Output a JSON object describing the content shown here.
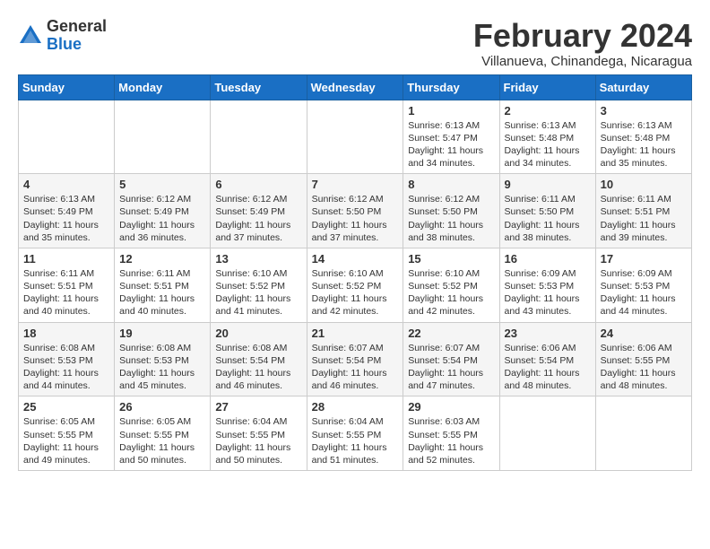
{
  "header": {
    "logo_general": "General",
    "logo_blue": "Blue",
    "month_title": "February 2024",
    "location": "Villanueva, Chinandega, Nicaragua"
  },
  "days_of_week": [
    "Sunday",
    "Monday",
    "Tuesday",
    "Wednesday",
    "Thursday",
    "Friday",
    "Saturday"
  ],
  "weeks": [
    [
      {
        "day": "",
        "info": ""
      },
      {
        "day": "",
        "info": ""
      },
      {
        "day": "",
        "info": ""
      },
      {
        "day": "",
        "info": ""
      },
      {
        "day": "1",
        "info": "Sunrise: 6:13 AM\nSunset: 5:47 PM\nDaylight: 11 hours and 34 minutes."
      },
      {
        "day": "2",
        "info": "Sunrise: 6:13 AM\nSunset: 5:48 PM\nDaylight: 11 hours and 34 minutes."
      },
      {
        "day": "3",
        "info": "Sunrise: 6:13 AM\nSunset: 5:48 PM\nDaylight: 11 hours and 35 minutes."
      }
    ],
    [
      {
        "day": "4",
        "info": "Sunrise: 6:13 AM\nSunset: 5:49 PM\nDaylight: 11 hours and 35 minutes."
      },
      {
        "day": "5",
        "info": "Sunrise: 6:12 AM\nSunset: 5:49 PM\nDaylight: 11 hours and 36 minutes."
      },
      {
        "day": "6",
        "info": "Sunrise: 6:12 AM\nSunset: 5:49 PM\nDaylight: 11 hours and 37 minutes."
      },
      {
        "day": "7",
        "info": "Sunrise: 6:12 AM\nSunset: 5:50 PM\nDaylight: 11 hours and 37 minutes."
      },
      {
        "day": "8",
        "info": "Sunrise: 6:12 AM\nSunset: 5:50 PM\nDaylight: 11 hours and 38 minutes."
      },
      {
        "day": "9",
        "info": "Sunrise: 6:11 AM\nSunset: 5:50 PM\nDaylight: 11 hours and 38 minutes."
      },
      {
        "day": "10",
        "info": "Sunrise: 6:11 AM\nSunset: 5:51 PM\nDaylight: 11 hours and 39 minutes."
      }
    ],
    [
      {
        "day": "11",
        "info": "Sunrise: 6:11 AM\nSunset: 5:51 PM\nDaylight: 11 hours and 40 minutes."
      },
      {
        "day": "12",
        "info": "Sunrise: 6:11 AM\nSunset: 5:51 PM\nDaylight: 11 hours and 40 minutes."
      },
      {
        "day": "13",
        "info": "Sunrise: 6:10 AM\nSunset: 5:52 PM\nDaylight: 11 hours and 41 minutes."
      },
      {
        "day": "14",
        "info": "Sunrise: 6:10 AM\nSunset: 5:52 PM\nDaylight: 11 hours and 42 minutes."
      },
      {
        "day": "15",
        "info": "Sunrise: 6:10 AM\nSunset: 5:52 PM\nDaylight: 11 hours and 42 minutes."
      },
      {
        "day": "16",
        "info": "Sunrise: 6:09 AM\nSunset: 5:53 PM\nDaylight: 11 hours and 43 minutes."
      },
      {
        "day": "17",
        "info": "Sunrise: 6:09 AM\nSunset: 5:53 PM\nDaylight: 11 hours and 44 minutes."
      }
    ],
    [
      {
        "day": "18",
        "info": "Sunrise: 6:08 AM\nSunset: 5:53 PM\nDaylight: 11 hours and 44 minutes."
      },
      {
        "day": "19",
        "info": "Sunrise: 6:08 AM\nSunset: 5:53 PM\nDaylight: 11 hours and 45 minutes."
      },
      {
        "day": "20",
        "info": "Sunrise: 6:08 AM\nSunset: 5:54 PM\nDaylight: 11 hours and 46 minutes."
      },
      {
        "day": "21",
        "info": "Sunrise: 6:07 AM\nSunset: 5:54 PM\nDaylight: 11 hours and 46 minutes."
      },
      {
        "day": "22",
        "info": "Sunrise: 6:07 AM\nSunset: 5:54 PM\nDaylight: 11 hours and 47 minutes."
      },
      {
        "day": "23",
        "info": "Sunrise: 6:06 AM\nSunset: 5:54 PM\nDaylight: 11 hours and 48 minutes."
      },
      {
        "day": "24",
        "info": "Sunrise: 6:06 AM\nSunset: 5:55 PM\nDaylight: 11 hours and 48 minutes."
      }
    ],
    [
      {
        "day": "25",
        "info": "Sunrise: 6:05 AM\nSunset: 5:55 PM\nDaylight: 11 hours and 49 minutes."
      },
      {
        "day": "26",
        "info": "Sunrise: 6:05 AM\nSunset: 5:55 PM\nDaylight: 11 hours and 50 minutes."
      },
      {
        "day": "27",
        "info": "Sunrise: 6:04 AM\nSunset: 5:55 PM\nDaylight: 11 hours and 50 minutes."
      },
      {
        "day": "28",
        "info": "Sunrise: 6:04 AM\nSunset: 5:55 PM\nDaylight: 11 hours and 51 minutes."
      },
      {
        "day": "29",
        "info": "Sunrise: 6:03 AM\nSunset: 5:55 PM\nDaylight: 11 hours and 52 minutes."
      },
      {
        "day": "",
        "info": ""
      },
      {
        "day": "",
        "info": ""
      }
    ]
  ]
}
